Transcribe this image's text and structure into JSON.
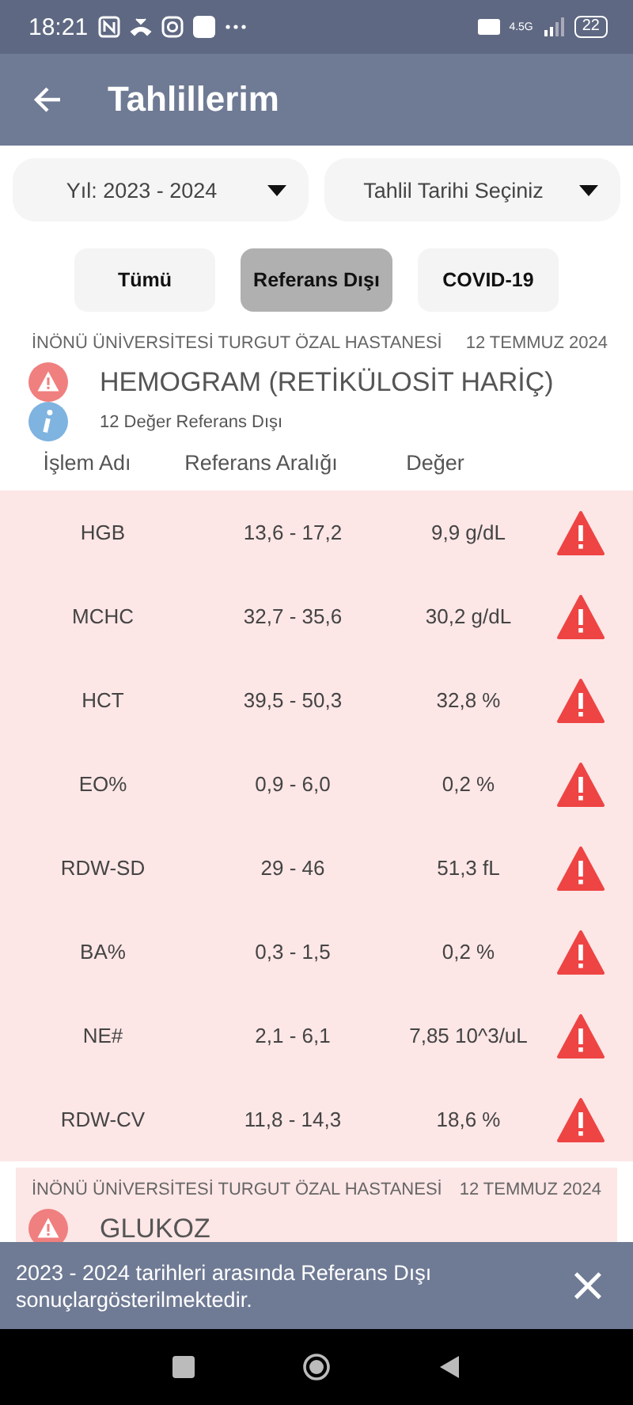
{
  "status_bar": {
    "time": "18:21",
    "network": "4.5G",
    "battery": "22"
  },
  "app_bar": {
    "title": "Tahlillerim"
  },
  "filters": [
    {
      "label": "Yıl: 2023 - 2024"
    },
    {
      "label": "Tahlil Tarihi Seçiniz"
    }
  ],
  "tabs": [
    {
      "label": "Tümü",
      "selected": false
    },
    {
      "label": "Referans Dışı",
      "selected": true
    },
    {
      "label": "COVID-19",
      "selected": false
    }
  ],
  "results": [
    {
      "hospital": "İNÖNÜ ÜNİVERSİTESİ TURGUT ÖZAL  HASTANESİ",
      "date": "12 TEMMUZ 2024",
      "test": "HEMOGRAM (RETİKÜLOSİT HARİÇ)",
      "summary": "12 Değer Referans Dışı",
      "columns": [
        "İşlem Adı",
        "Referans Aralığı",
        "Değer"
      ],
      "rows": [
        {
          "name": "HGB",
          "range": "13,6 - 17,2",
          "value": "9,9 g/dL"
        },
        {
          "name": "MCHC",
          "range": "32,7 - 35,6",
          "value": "30,2 g/dL"
        },
        {
          "name": "HCT",
          "range": "39,5 - 50,3",
          "value": "32,8 %"
        },
        {
          "name": "EO%",
          "range": "0,9 - 6,0",
          "value": "0,2 %"
        },
        {
          "name": "RDW-SD",
          "range": "29 - 46",
          "value": "51,3 fL"
        },
        {
          "name": "BA%",
          "range": "0,3 - 1,5",
          "value": "0,2 %"
        },
        {
          "name": "NE#",
          "range": "2,1 - 6,1",
          "value": "7,85 10^3/uL"
        },
        {
          "name": "RDW-CV",
          "range": "11,8 - 14,3",
          "value": "18,6 %"
        }
      ]
    },
    {
      "hospital": "İNÖNÜ ÜNİVERSİTESİ TURGUT ÖZAL  HASTANESİ",
      "date": "12 TEMMUZ 2024",
      "test": "GLUKOZ"
    }
  ],
  "snackbar": {
    "message": "2023 - 2024 tarihleri arasında Referans Dışı sonuçlargösterilmektedir.",
    "close": "×"
  }
}
